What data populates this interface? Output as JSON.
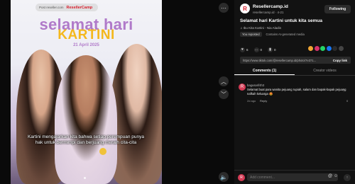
{
  "video": {
    "brand_url": "Post reseller.com",
    "brand_name": "ResellerCamp",
    "headline_line1": "selamat hari",
    "headline_line2": "KARTINI",
    "date": "21 April 2025",
    "caption": "Kartini mengajarkan kita bahwa setiap perempuan punya hak untuk bermimpi dan berjuang meraih cita-cita"
  },
  "controls": {
    "menu_icon": "more-horizontal-icon",
    "up_icon": "chevron-up-icon",
    "down_icon": "chevron-down-icon",
    "volume_icon": "volume-icon"
  },
  "panel": {
    "account": {
      "name": "Resellercamp.id",
      "sub": "resellercamp.id · 4-21",
      "follow_label": "Following"
    },
    "post_title": "Selamat hari Kartini untuk kita semua",
    "music": "♫ Ibu Kita Kartini - Nia Aladin",
    "repost_label": "You reposted",
    "ai_label": "Contains AI-generated media",
    "actions": [
      {
        "icon": "heart-icon",
        "count": "6"
      },
      {
        "icon": "comment-icon",
        "count": "0"
      },
      {
        "icon": "bookmark-icon",
        "count": "0"
      }
    ],
    "share_colors": [
      "#f0a534",
      "#d6336c",
      "#25d366",
      "#1877f2",
      "#2b2b2b",
      "#444"
    ],
    "link": "https://www.tiktok.com/@resellercamp.id/photo/7e371...",
    "copy_label": "Copy link",
    "tabs": [
      {
        "label": "Comments (1)",
        "active": true
      },
      {
        "label": "Creator videos",
        "active": false
      }
    ],
    "comment": {
      "avatar_letter": "R",
      "user": "bagusarif4h3",
      "text": "Selamat buat para wanita pejuang rupiah, salam dan bapak-bapak pejuang nafkah keluarga 😍",
      "time": "2d ago",
      "reply_label": "Reply",
      "likes": "0"
    },
    "compose": {
      "avatar_letter": "R",
      "placeholder": "Add comment...",
      "at_icon": "at-icon",
      "emoji_icon": "emoji-icon",
      "post_label": "Post"
    }
  }
}
